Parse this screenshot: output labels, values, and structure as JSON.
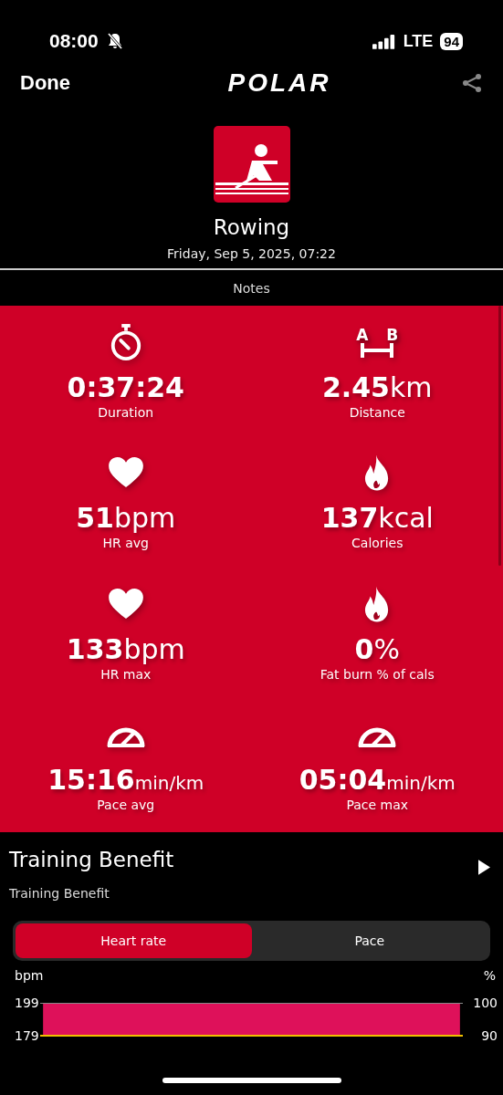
{
  "status_bar": {
    "time": "08:00",
    "network": "LTE",
    "battery": "94"
  },
  "header": {
    "done": "Done",
    "logo": "POLAR"
  },
  "activity": {
    "name": "Rowing",
    "date": "Friday, Sep 5, 2025, 07:22"
  },
  "notes": "Notes",
  "distance_icon_letters": [
    "A",
    "B"
  ],
  "metrics": [
    {
      "kind": "stopwatch",
      "value": "0:37:24",
      "label": "Duration"
    },
    {
      "kind": "distance",
      "value": "2.45",
      "unit": "km",
      "label": "Distance"
    },
    {
      "kind": "heart",
      "value": "51",
      "unit": "bpm",
      "label": "HR avg"
    },
    {
      "kind": "flame",
      "value": "137",
      "unit": "kcal",
      "label": "Calories"
    },
    {
      "kind": "heart",
      "value": "133",
      "unit": "bpm",
      "label": "HR max"
    },
    {
      "kind": "flame",
      "value": "0",
      "unit": "%",
      "label": "Fat burn % of cals"
    },
    {
      "kind": "gauge",
      "value": "15:16",
      "unit": "min/km",
      "label": "Pace avg"
    },
    {
      "kind": "gauge",
      "value": "05:04",
      "unit": "min/km",
      "label": "Pace max"
    }
  ],
  "training_benefit": {
    "title": "Training Benefit",
    "subtitle": "Training Benefit",
    "tabs": [
      {
        "label": "Heart rate",
        "selected": true
      },
      {
        "label": "Pace",
        "selected": false
      }
    ],
    "left_axis": {
      "unit": "bpm",
      "ticks": [
        "199",
        "179"
      ]
    },
    "right_axis": {
      "unit": "%",
      "ticks": [
        "100",
        "90"
      ]
    }
  }
}
